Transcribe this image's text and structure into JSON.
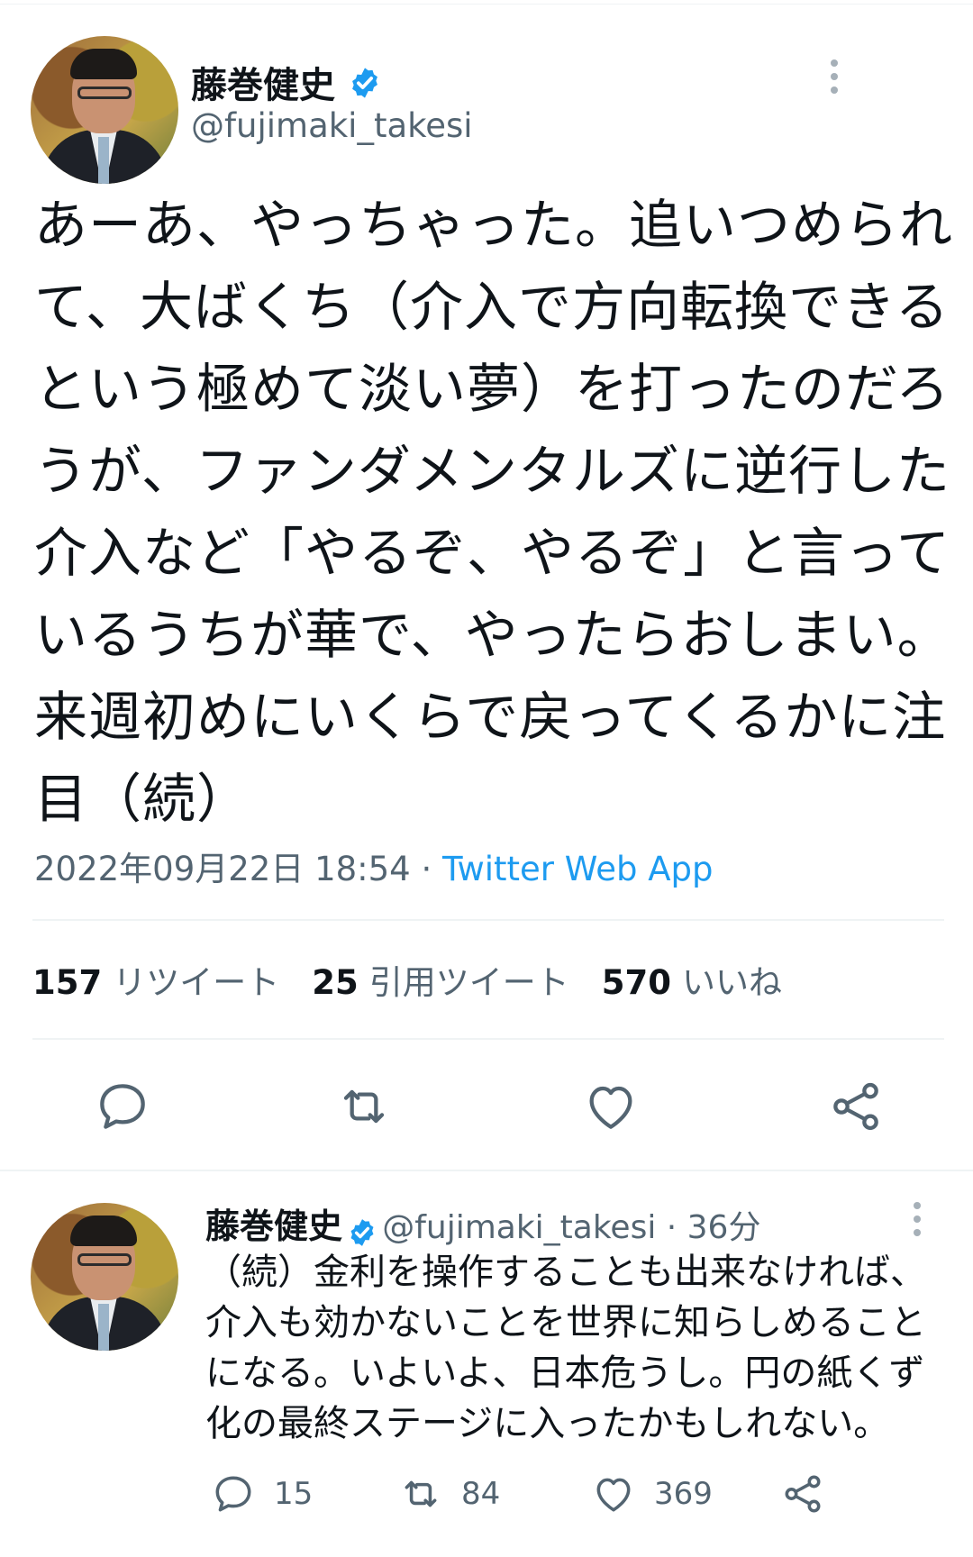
{
  "tweet": {
    "author_name": "藤巻健史",
    "handle": "@fujimaki_takesi",
    "text_lines": [
      "あーあ、やっちゃった。追いつめられ",
      "て、大ばくち（介入で方向転換できる",
      "という極めて淡い夢）を打ったのだろ",
      "うが、ファンダメンタルズに逆行した",
      "介入など「やるぞ、やるぞ」と言って",
      "いるうちが華で、やったらおしまい。",
      "来週初めにいくらで戻ってくるかに注",
      "目（続）"
    ],
    "timestamp": "2022年09月22日 18:54",
    "separator": " · ",
    "source_app": "Twitter Web App",
    "stats": {
      "retweets_count": "157",
      "retweets_label": "リツイート",
      "quotes_count": "25",
      "quotes_label": "引用ツイート",
      "likes_count": "570",
      "likes_label": "いいね"
    }
  },
  "reply": {
    "author_name": "藤巻健史",
    "handle_time": "@fujimaki_takesi · 36分",
    "text_lines": [
      "（続）金利を操作することも出来なければ、",
      "介入も効かないことを世界に知らしめること",
      "になる。いよいよ、日本危うし。円の紙くず",
      "化の最終ステージに入ったかもしれない。"
    ],
    "counts": {
      "replies": "15",
      "retweets": "84",
      "likes": "369"
    }
  },
  "colors": {
    "verified_blue": "#1d9bf0",
    "link_blue": "#1d9bf0",
    "secondary_text": "#536471",
    "divider": "#eff3f4"
  },
  "icons": [
    "verified-badge-icon",
    "more-options-icon",
    "reply-icon",
    "retweet-icon",
    "like-icon",
    "share-icon"
  ]
}
